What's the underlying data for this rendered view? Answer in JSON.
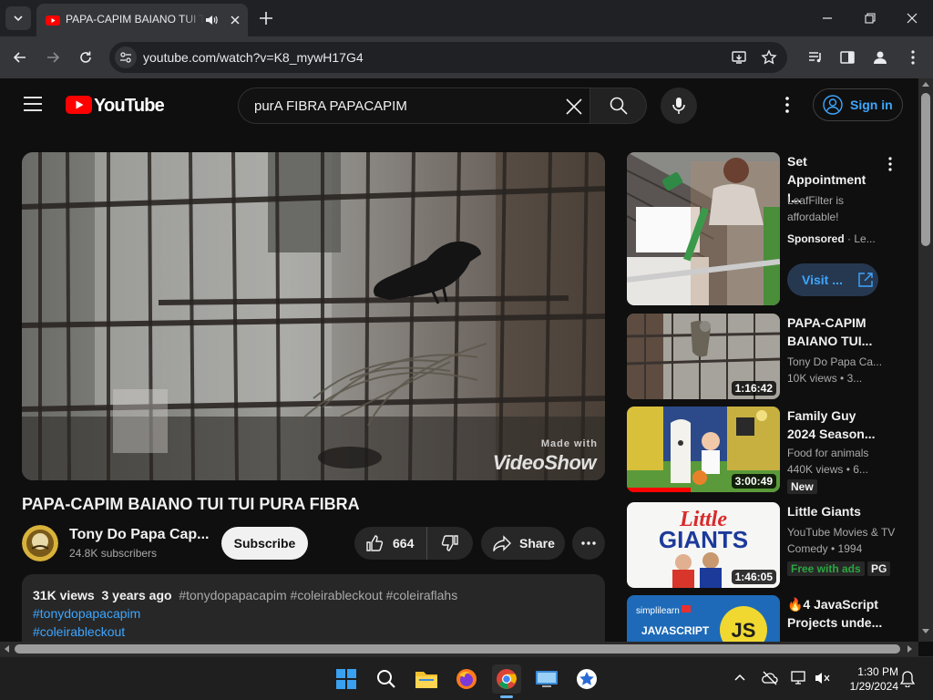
{
  "browser": {
    "tab_title": "PAPA-CAPIM BAIANO TUI TUI PURA FIBRA",
    "url": "youtube.com/watch?v=K8_mywH17G4"
  },
  "header": {
    "logo_text": "YouTube",
    "search_value": "purA FIBRA PAPACAPIM",
    "sign_in_label": "Sign in"
  },
  "player": {
    "watermark_line1": "Made with",
    "watermark_line2": "VideoShow"
  },
  "video": {
    "title": "PAPA-CAPIM BAIANO TUI TUI PURA FIBRA",
    "channel_name": "Tony Do Papa Cap...",
    "subscribers": "24.8K subscribers",
    "subscribe_label": "Subscribe",
    "like_count": "664",
    "share_label": "Share",
    "views": "31K views",
    "age": "3 years ago",
    "tags": [
      "#tonydopapacapim",
      "#coleirableckout",
      "#coleiraflahs"
    ],
    "desc_tag_1": "#tonydopapacapim",
    "desc_tag_2": "#coleirableckout"
  },
  "sidebar": {
    "ad": {
      "title_line1": "Set",
      "title_line2": "Appointment I...",
      "advertiser": "LeafFilter is",
      "advertiser_line2": "affordable!",
      "sponsored": "Sponsored",
      "sponsor_short": "Le...",
      "visit_label": "Visit ..."
    },
    "items": [
      {
        "title_line1": "PAPA-CAPIM",
        "title_line2": "BAIANO TUI...",
        "channel": "Tony Do Papa Ca...",
        "meta": "10K views",
        "meta2": "3...",
        "duration": "1:16:42"
      },
      {
        "title_line1": "Family Guy",
        "title_line2": "2024 Season...",
        "channel": "Food for animals",
        "meta": "440K views",
        "meta2": "6...",
        "duration": "3:00:49",
        "badge": "New"
      },
      {
        "title_line1": "Little Giants",
        "title_line2": "",
        "channel": "YouTube Movies & TV",
        "meta": "Comedy • 1994",
        "duration": "1:46:05",
        "badge_ads": "Free with ads",
        "badge_rating": "PG"
      },
      {
        "title_line1": "🔥4 JavaScript",
        "title_line2": "Projects unde..."
      }
    ],
    "thumb_text": {
      "little": "Little",
      "giants": "GIANTS",
      "js_brand": "simplilearn",
      "js_word": "JAVASCRIPT",
      "js_logo": "JS"
    }
  },
  "taskbar": {
    "time": "1:30 PM",
    "date": "1/29/2024"
  }
}
